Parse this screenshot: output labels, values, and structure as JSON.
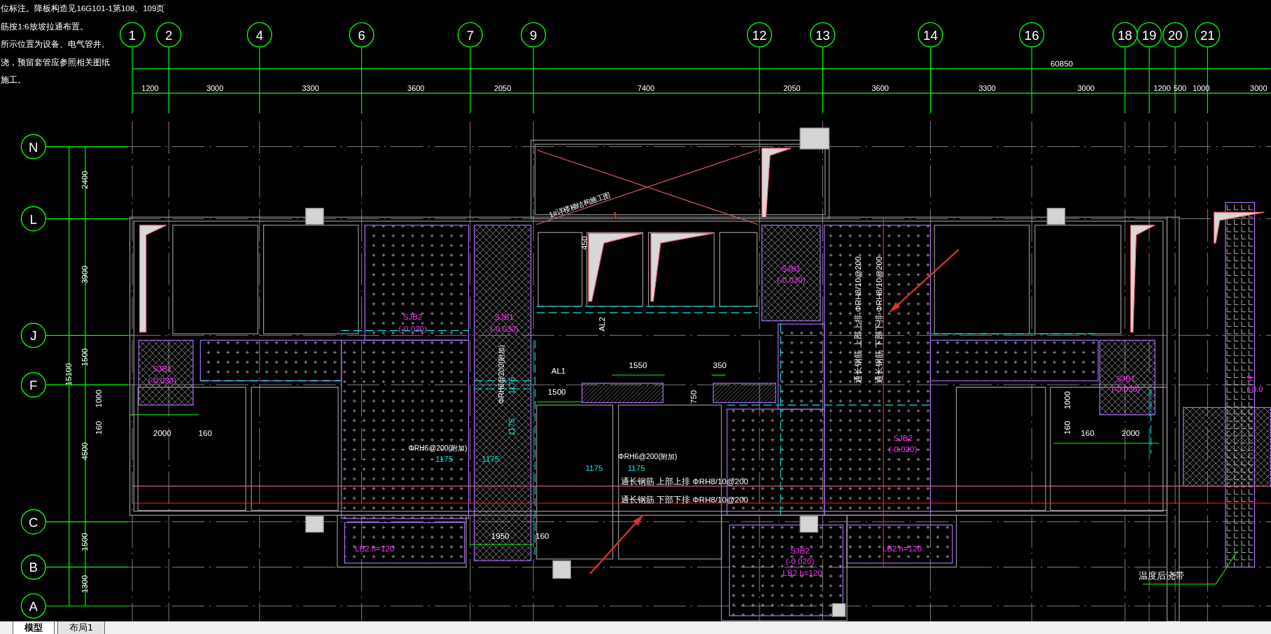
{
  "notes": [
    "位标注。降板构造见16G101-1第108、109页",
    "筋按1:6放坡拉通布置。",
    "所示位置为设备、电气管井,",
    "浇，预留套管应参照相关图纸",
    "施工。"
  ],
  "column_axes": [
    {
      "label": "1"
    },
    {
      "label": "2"
    },
    {
      "label": "4"
    },
    {
      "label": "6"
    },
    {
      "label": "7"
    },
    {
      "label": "9"
    },
    {
      "label": "12"
    },
    {
      "label": "13"
    },
    {
      "label": "14"
    },
    {
      "label": "16"
    },
    {
      "label": "18"
    },
    {
      "label": "19"
    },
    {
      "label": "20"
    },
    {
      "label": "21"
    }
  ],
  "row_axes": [
    {
      "label": "N"
    },
    {
      "label": "L"
    },
    {
      "label": "J"
    },
    {
      "label": "F"
    },
    {
      "label": "C"
    },
    {
      "label": "B"
    },
    {
      "label": "A"
    }
  ],
  "overall_dimension": "60850",
  "bay_dimensions": [
    "1200",
    "3000",
    "3300",
    "3600",
    "2050",
    "7400",
    "2050",
    "3600",
    "3300",
    "3000",
    "1200",
    "500",
    "1000",
    "3000"
  ],
  "left_overall_dimension": "15100",
  "left_dimensions": [
    "2400",
    "3900",
    "1500",
    "4500",
    "1500",
    "1300"
  ],
  "annotations": [
    {
      "kind": "slab",
      "text": "SJB1"
    },
    {
      "kind": "slab",
      "text": "(-0.030)"
    },
    {
      "kind": "slab",
      "text": "SJB2"
    },
    {
      "kind": "slab",
      "text": "(-0.020)"
    },
    {
      "kind": "slab",
      "text": "SJB1"
    },
    {
      "kind": "slab",
      "text": "(-0.030)"
    },
    {
      "kind": "slab",
      "text": "SJB1"
    },
    {
      "kind": "slab",
      "text": "(-0.030)"
    },
    {
      "kind": "slab",
      "text": "SJB2"
    },
    {
      "kind": "slab",
      "text": "(-0.020)"
    },
    {
      "kind": "slab",
      "text": "SJB1"
    },
    {
      "kind": "slab",
      "text": "(-0.030)"
    },
    {
      "kind": "slab",
      "text": "SJB2"
    },
    {
      "kind": "slab",
      "text": "(-0.020)"
    },
    {
      "kind": "slab",
      "text": "LB2 h=120"
    },
    {
      "kind": "slab",
      "text": "LB2 h=120"
    },
    {
      "kind": "slab",
      "text": "LB2 h=120"
    },
    {
      "kind": "slab",
      "text": "S."
    },
    {
      "kind": "slab",
      "text": "(-0.0"
    },
    {
      "kind": "rebar",
      "text": "ΦRH6@200(附加)"
    },
    {
      "kind": "rebar",
      "text": "ΦRH6@200(附加)"
    },
    {
      "kind": "length",
      "text": "1175"
    },
    {
      "kind": "length",
      "text": "1175"
    },
    {
      "kind": "length",
      "text": "1175"
    },
    {
      "kind": "length",
      "text": "1175"
    },
    {
      "kind": "dimension",
      "text": "2000"
    },
    {
      "kind": "dimension",
      "text": "160"
    },
    {
      "kind": "dimension",
      "text": "1550"
    },
    {
      "kind": "dimension",
      "text": "350"
    },
    {
      "kind": "dimension",
      "text": "1500"
    },
    {
      "kind": "dimension",
      "text": "750"
    },
    {
      "kind": "dimension",
      "text": "450"
    },
    {
      "kind": "dimension",
      "text": "AL1"
    },
    {
      "kind": "dimension",
      "text": "AL2"
    },
    {
      "kind": "rebar",
      "text": "ΦRH6@200(附加)"
    },
    {
      "kind": "length",
      "text": "1175"
    },
    {
      "kind": "length",
      "text": "1175"
    },
    {
      "kind": "rebar",
      "text": "通长钢筋 上部上排 ΦRH8/10@200"
    },
    {
      "kind": "rebar",
      "text": "通长钢筋 下部下排 ΦRH8/10@200"
    },
    {
      "kind": "rebar",
      "text": "通长钢筋 上部上排 ΦRH8/10@200"
    },
    {
      "kind": "rebar",
      "text": "通长钢筋 下部下排 ΦRH8/10@200"
    },
    {
      "kind": "section",
      "text": "1"
    },
    {
      "kind": "rebar",
      "text": "1#详楼梯结构施工图"
    },
    {
      "kind": "dimension",
      "text": "1000"
    },
    {
      "kind": "dimension",
      "text": "160"
    },
    {
      "kind": "dimension",
      "text": "160"
    },
    {
      "kind": "dimension",
      "text": "2000"
    },
    {
      "kind": "dimension",
      "text": "1000"
    },
    {
      "kind": "dimension",
      "text": "160"
    },
    {
      "kind": "dimension",
      "text": "1950"
    },
    {
      "kind": "dimension",
      "text": "160"
    },
    {
      "kind": "note",
      "text": "温度后浇带"
    }
  ],
  "tabs": [
    {
      "label": "模型",
      "selected": true
    },
    {
      "label": "布局1",
      "selected": false
    }
  ]
}
